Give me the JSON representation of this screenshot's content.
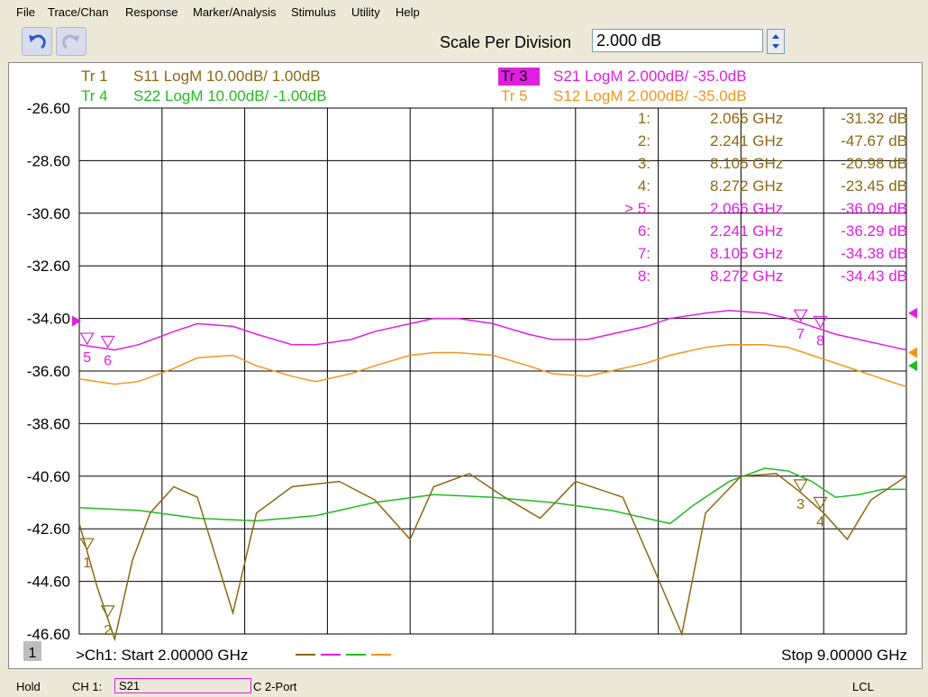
{
  "menu": [
    "File",
    "Trace/Chan",
    "Response",
    "Marker/Analysis",
    "Stimulus",
    "Utility",
    "Help"
  ],
  "toolbar": {
    "scale_label": "Scale Per Division",
    "scale_value": "2.000 dB"
  },
  "icons": {
    "undo": "undo-icon",
    "redo": "redo-icon",
    "spin": "spinner-arrows-icon"
  },
  "traces": [
    {
      "tr": "Tr  1",
      "desc": "S11 LogM 10.00dB/  1.00dB",
      "color": "#8b6914"
    },
    {
      "tr": "Tr  4",
      "desc": "S22 LogM 10.00dB/  -1.00dB",
      "color": "#22bb22"
    },
    {
      "tr": "Tr  3",
      "desc": "S21 LogM 2.000dB/  -35.0dB",
      "color": "#e020e0"
    },
    {
      "tr": "Tr  5",
      "desc": "S12 LogM 2.000dB/  -35.0dB",
      "color": "#f0961e"
    }
  ],
  "markers": [
    {
      "id": "1:",
      "freq": "2.066 GHz",
      "val": "-31.32 dB",
      "color": "#8b6914"
    },
    {
      "id": "2:",
      "freq": "2.241 GHz",
      "val": "-47.67 dB",
      "color": "#8b6914"
    },
    {
      "id": "3:",
      "freq": "8.105 GHz",
      "val": "-20.98 dB",
      "color": "#8b6914"
    },
    {
      "id": "4:",
      "freq": "8.272 GHz",
      "val": "-23.45 dB",
      "color": "#8b6914"
    },
    {
      "id": "> 5:",
      "freq": "2.066 GHz",
      "val": "-36.09 dB",
      "color": "#e020e0"
    },
    {
      "id": "6:",
      "freq": "2.241 GHz",
      "val": "-36.29 dB",
      "color": "#e020e0"
    },
    {
      "id": "7:",
      "freq": "8.105 GHz",
      "val": "-34.38 dB",
      "color": "#e020e0"
    },
    {
      "id": "8:",
      "freq": "8.272 GHz",
      "val": "-34.43 dB",
      "color": "#e020e0"
    }
  ],
  "yticks": [
    "-26.60",
    "-28.60",
    "-30.60",
    "-32.60",
    "-34.60",
    "-36.60",
    "-38.60",
    "-40.60",
    "-42.60",
    "-44.60",
    "-46.60"
  ],
  "channel_number": "1",
  "start_label": ">Ch1:  Start  2.00000 GHz",
  "stop_label": "Stop  9.00000 GHz",
  "marker_labels": [
    "1",
    "2",
    "3",
    "4",
    "5",
    "6",
    "7",
    "8"
  ],
  "status": {
    "hold": "Hold",
    "ch": "CH 1:",
    "trace": "S21",
    "cal": "C  2-Port",
    "lcl": "LCL"
  },
  "chart_data": {
    "type": "line",
    "x_range_ghz": [
      2,
      9
    ],
    "ylim_db": [
      -46.6,
      -26.6
    ],
    "grid": true,
    "series": [
      {
        "name": "S21",
        "color": "#e020e0",
        "x": [
          2.0,
          2.3,
          2.5,
          2.8,
          3.0,
          3.3,
          3.5,
          3.8,
          4.0,
          4.3,
          4.5,
          4.8,
          5.0,
          5.2,
          5.5,
          5.8,
          6.0,
          6.3,
          6.5,
          6.8,
          7.0,
          7.3,
          7.5,
          7.8,
          8.0,
          8.2,
          8.4,
          8.6,
          8.8,
          9.0
        ],
        "y": [
          -35.6,
          -35.8,
          -35.6,
          -35.1,
          -34.8,
          -34.9,
          -35.2,
          -35.6,
          -35.6,
          -35.4,
          -35.1,
          -34.8,
          -34.6,
          -34.6,
          -34.8,
          -35.2,
          -35.4,
          -35.4,
          -35.2,
          -34.9,
          -34.6,
          -34.4,
          -34.3,
          -34.4,
          -34.6,
          -34.9,
          -35.2,
          -35.4,
          -35.6,
          -35.8
        ],
        "marker_ids": [
          5,
          6,
          7,
          8
        ]
      },
      {
        "name": "S12",
        "color": "#f0961e",
        "x": [
          2.0,
          2.3,
          2.5,
          2.8,
          3.0,
          3.3,
          3.5,
          3.8,
          4.0,
          4.3,
          4.5,
          4.8,
          5.0,
          5.2,
          5.5,
          5.8,
          6.0,
          6.3,
          6.5,
          6.8,
          7.0,
          7.3,
          7.5,
          7.8,
          8.0,
          8.2,
          8.4,
          8.6,
          8.8,
          9.0
        ],
        "y": [
          -36.9,
          -37.1,
          -37.0,
          -36.5,
          -36.1,
          -36.0,
          -36.4,
          -36.8,
          -37.0,
          -36.7,
          -36.4,
          -36.0,
          -35.9,
          -35.9,
          -36.0,
          -36.4,
          -36.7,
          -36.8,
          -36.6,
          -36.3,
          -36.0,
          -35.7,
          -35.6,
          -35.6,
          -35.7,
          -36.0,
          -36.3,
          -36.6,
          -36.9,
          -37.2
        ]
      },
      {
        "name": "S22",
        "color": "#22bb22",
        "x": [
          2.0,
          2.5,
          3.0,
          3.5,
          4.0,
          4.5,
          5.0,
          5.5,
          6.0,
          6.5,
          7.0,
          7.2,
          7.5,
          7.8,
          8.0,
          8.2,
          8.4,
          8.6,
          8.8,
          9.0
        ],
        "y": [
          -41.8,
          -41.9,
          -42.2,
          -42.3,
          -42.1,
          -41.6,
          -41.3,
          -41.4,
          -41.6,
          -41.9,
          -42.4,
          -41.7,
          -40.8,
          -40.3,
          -40.4,
          -40.8,
          -41.4,
          -41.3,
          -41.1,
          -41.1
        ],
        "marker_ids": []
      },
      {
        "name": "S11",
        "color": "#8b6914",
        "x": [
          2.0,
          2.15,
          2.3,
          2.45,
          2.6,
          2.8,
          3.0,
          3.3,
          3.5,
          3.8,
          4.2,
          4.5,
          4.8,
          5.0,
          5.3,
          5.6,
          5.9,
          6.2,
          6.6,
          6.9,
          7.1,
          7.3,
          7.6,
          7.9,
          8.1,
          8.3,
          8.5,
          8.7,
          8.9,
          9.0
        ],
        "y": [
          -42.4,
          -44.8,
          -46.8,
          -43.8,
          -42.0,
          -41.0,
          -41.4,
          -45.8,
          -42.0,
          -41.0,
          -40.8,
          -41.5,
          -43.0,
          -41.0,
          -40.5,
          -41.4,
          -42.2,
          -40.8,
          -41.4,
          -44.5,
          -46.6,
          -42.0,
          -40.6,
          -40.5,
          -41.2,
          -42.0,
          -43.0,
          -41.5,
          -40.9,
          -40.6
        ],
        "marker_ids": [
          1,
          2,
          3,
          4
        ]
      }
    ]
  }
}
